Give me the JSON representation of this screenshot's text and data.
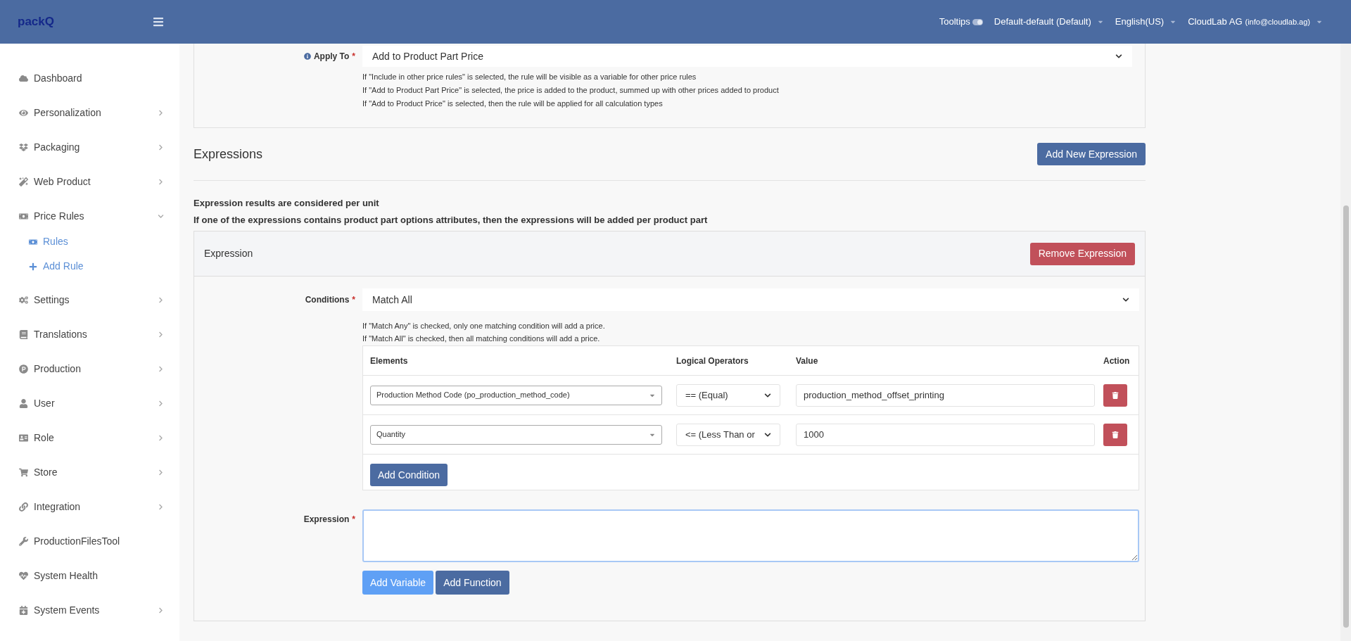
{
  "header": {
    "logo": "packQ",
    "tooltips": {
      "label": "Tooltips",
      "on": true
    },
    "menus": [
      "Default-default (Default)",
      "English(US)"
    ],
    "account": {
      "name": "CloudLab AG",
      "email": "(info@cloudlab.ag)"
    }
  },
  "sidebar": {
    "items": [
      {
        "label": "Dashboard"
      },
      {
        "label": "Personalization",
        "expanded": false
      },
      {
        "label": "Packaging",
        "expanded": false
      },
      {
        "label": "Web Product",
        "expanded": false
      },
      {
        "label": "Price Rules",
        "expanded": true,
        "children": [
          {
            "label": "Rules"
          },
          {
            "label": "Add Rule"
          }
        ]
      },
      {
        "label": "Settings",
        "expanded": false
      },
      {
        "label": "Translations",
        "expanded": false
      },
      {
        "label": "Production",
        "expanded": false
      },
      {
        "label": "User",
        "expanded": false
      },
      {
        "label": "Role",
        "expanded": false
      },
      {
        "label": "Store",
        "expanded": false
      },
      {
        "label": "Integration",
        "expanded": false
      },
      {
        "label": "ProductionFilesTool"
      },
      {
        "label": "System Health"
      },
      {
        "label": "System Events",
        "expanded": false
      }
    ]
  },
  "apply_to": {
    "label": "Apply To",
    "required_mark": "*",
    "value": "Add to Product Part Price",
    "help": [
      "If \"Include in other price rules\" is selected, the rule will be visible as a variable for other price rules",
      "If \"Add to Product Part Price\" is selected, the price is added to the product, summed up with other prices added to product",
      "If \"Add to Product Price\" is selected, then the rule will be applied for all calculation types"
    ]
  },
  "expressions": {
    "title": "Expressions",
    "add_button": "Add New Expression",
    "notes": [
      "Expression results are considered per unit",
      "If one of the expressions contains product part options attributes, then the expressions will be added per product part"
    ],
    "card": {
      "title": "Expression",
      "remove_button": "Remove Expression",
      "conditions_label": "Conditions",
      "conditions_required_mark": "*",
      "conditions_value": "Match All",
      "help": [
        "If \"Match Any\" is checked, only one matching condition will add a price.",
        "If \"Match All\" is checked, then all matching conditions will add a price."
      ],
      "table": {
        "columns": [
          "Elements",
          "Logical Operators",
          "Value",
          "Action"
        ],
        "rows": [
          {
            "element": "Production Method Code (po_production_method_code)",
            "operator": "== (Equal)",
            "value": "production_method_offset_printing"
          },
          {
            "element": "Quantity",
            "operator": "<= (Less Than or",
            "value": "1000"
          }
        ]
      },
      "add_condition": "Add Condition",
      "expression_label": "Expression",
      "expression_required_mark": "*",
      "buttons": [
        "Add Variable",
        "Add Function"
      ]
    }
  }
}
